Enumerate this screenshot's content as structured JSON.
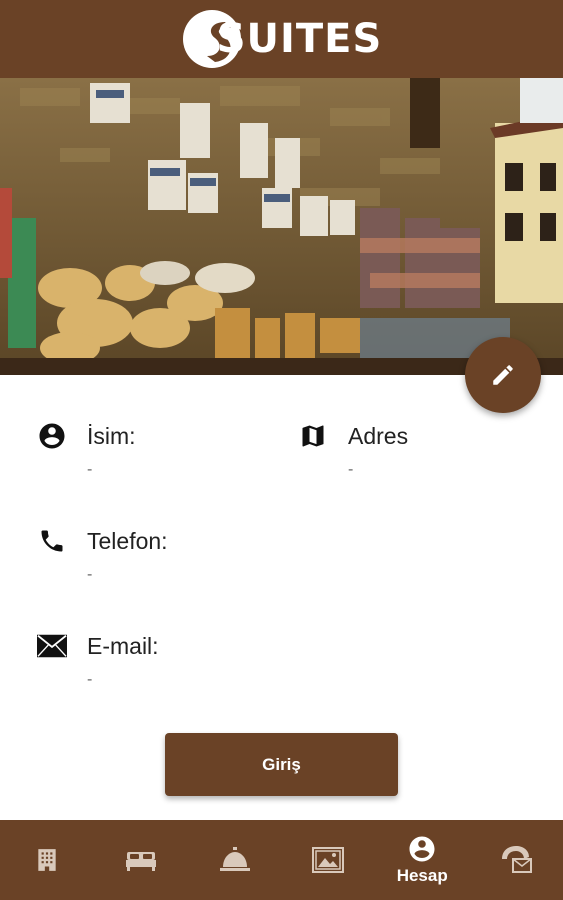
{
  "header": {
    "logo_text": "SUITES"
  },
  "hero": {
    "alt": "souvenir-market-photo"
  },
  "profile": {
    "name_label": "İsim:",
    "name_value": "-",
    "address_label": "Adres",
    "address_value": "-",
    "phone_label": "Telefon:",
    "phone_value": "-",
    "email_label": "E-mail:",
    "email_value": "-"
  },
  "login_button": "Giriş",
  "bottom_nav": {
    "active": "Hesap",
    "items": [
      {
        "icon": "building-icon",
        "label": ""
      },
      {
        "icon": "bed-icon",
        "label": ""
      },
      {
        "icon": "service-bell-icon",
        "label": ""
      },
      {
        "icon": "gallery-icon",
        "label": ""
      },
      {
        "icon": "account-icon",
        "label": "Hesap"
      },
      {
        "icon": "contact-icon",
        "label": ""
      }
    ]
  },
  "colors": {
    "brand": "#6a4226",
    "text": "#222222",
    "muted": "#666666"
  }
}
